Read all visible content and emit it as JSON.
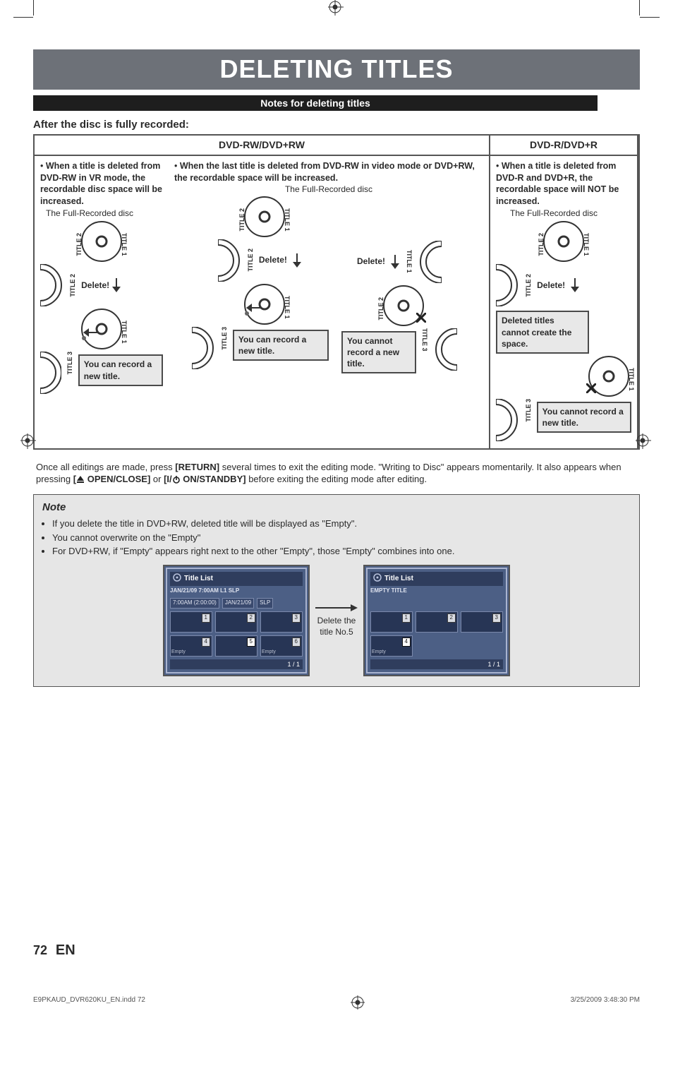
{
  "header": {
    "title": "DELETING TITLES",
    "sub_bar": "Notes for deleting titles",
    "after_heading": "After the disc is fully recorded:"
  },
  "table": {
    "head_rw": "DVD-RW/DVD+RW",
    "head_r": "DVD-R/DVD+R",
    "col1_bullet": "When a title is deleted from DVD-RW in VR mode, the recordable disc space will be increased.",
    "col2_bullet": "When the last title is deleted from DVD-RW in video mode or DVD+RW, the recordable space will be increased.",
    "col3_bullet": "When a title is deleted from DVD-R and DVD+R, the recordable space will NOT be increased.",
    "fullrec": "The Full-Recorded disc",
    "delete_label": "Delete!",
    "you_can": "You can record a new title.",
    "you_cannot": "You cannot record a new title.",
    "deleted_note": "Deleted titles cannot create the space.",
    "title1": "TITLE 1",
    "title2": "TITLE 2",
    "title3": "TITLE 3"
  },
  "paragraph": {
    "p1a": "Once all editings are made, press ",
    "p1b": "[RETURN]",
    "p1c": " several times to exit the editing mode. \"Writing to Disc\" appears momentarily. It also appears when pressing ",
    "p1d": "[",
    "p1e": " OPEN/CLOSE]",
    "p1f": " or ",
    "p1g": "[I/",
    "p1h": " ON/STANDBY]",
    "p1i": " before exiting the editing mode after editing."
  },
  "note": {
    "title": "Note",
    "n1": "If you delete the title in DVD+RW, deleted title will be displayed as \"Empty\".",
    "n2": "You cannot overwrite on the \"Empty\"",
    "n3": "For DVD+RW, if \"Empty\" appears right next to the other \"Empty\", those \"Empty\" combines into one."
  },
  "osd": {
    "title_list": "Title List",
    "empty_title": "EMPTY TITLE",
    "meta1": "JAN/21/09  7:00AM  L1  SLP",
    "meta_a": "7:00AM (2:00:00)",
    "meta_b": "JAN/21/09",
    "meta_c": "SLP",
    "empty": "Empty",
    "page": "1 / 1",
    "delete_between_a": "Delete the",
    "delete_between_b": "title No.5"
  },
  "footer": {
    "page_num": "72",
    "lang": "EN",
    "file": "E9PKAUD_DVR620KU_EN.indd   72",
    "timestamp": "3/25/2009   3:48:30 PM"
  }
}
